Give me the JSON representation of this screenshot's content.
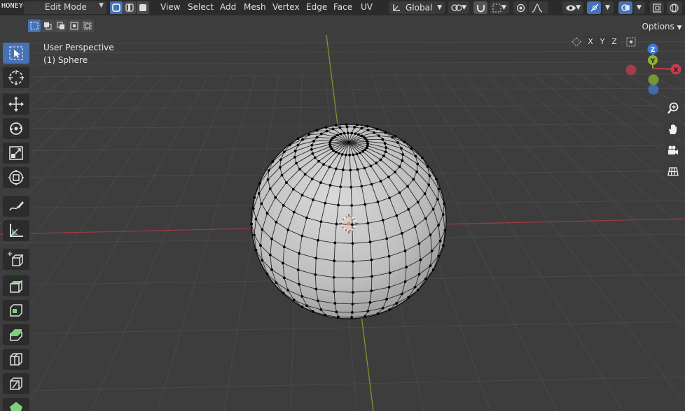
{
  "watermark": "HONEYCAM.ORG",
  "header": {
    "mode": "Edit Mode",
    "menus": [
      "View",
      "Select",
      "Add",
      "Mesh",
      "Vertex",
      "Edge",
      "Face",
      "UV"
    ],
    "transform_orientation": "Global"
  },
  "subheader": {
    "axes": [
      "X",
      "Y",
      "Z"
    ],
    "options_label": "Options"
  },
  "viewport": {
    "view_name": "User Perspective",
    "object_name": "(1) Sphere"
  },
  "gizmo": {
    "z_label": "Z",
    "y_label": "Y",
    "x_label": "X",
    "colors": {
      "x": "#c83a4c",
      "y": "#8bb42b",
      "z": "#3f7ad0"
    }
  },
  "colors": {
    "accent": "#4772b3",
    "background": "#3d3d3d",
    "header": "#2b2b2b",
    "x_axis_line": "#9a3a46",
    "y_axis_line": "#7a9a2a"
  },
  "toolbar": {
    "tools": [
      "select-box-icon",
      "cursor-icon",
      "move-icon",
      "rotate-icon",
      "scale-icon",
      "transform-icon",
      "annotate-icon",
      "measure-icon",
      "add-cube-icon",
      "extrude-icon",
      "inset-icon",
      "bevel-icon",
      "loop-cut-icon",
      "knife-icon",
      "poly-build-icon"
    ]
  },
  "nav_buttons": [
    "zoom-icon",
    "hand-pan-icon",
    "camera-icon",
    "grid-ortho-icon"
  ]
}
